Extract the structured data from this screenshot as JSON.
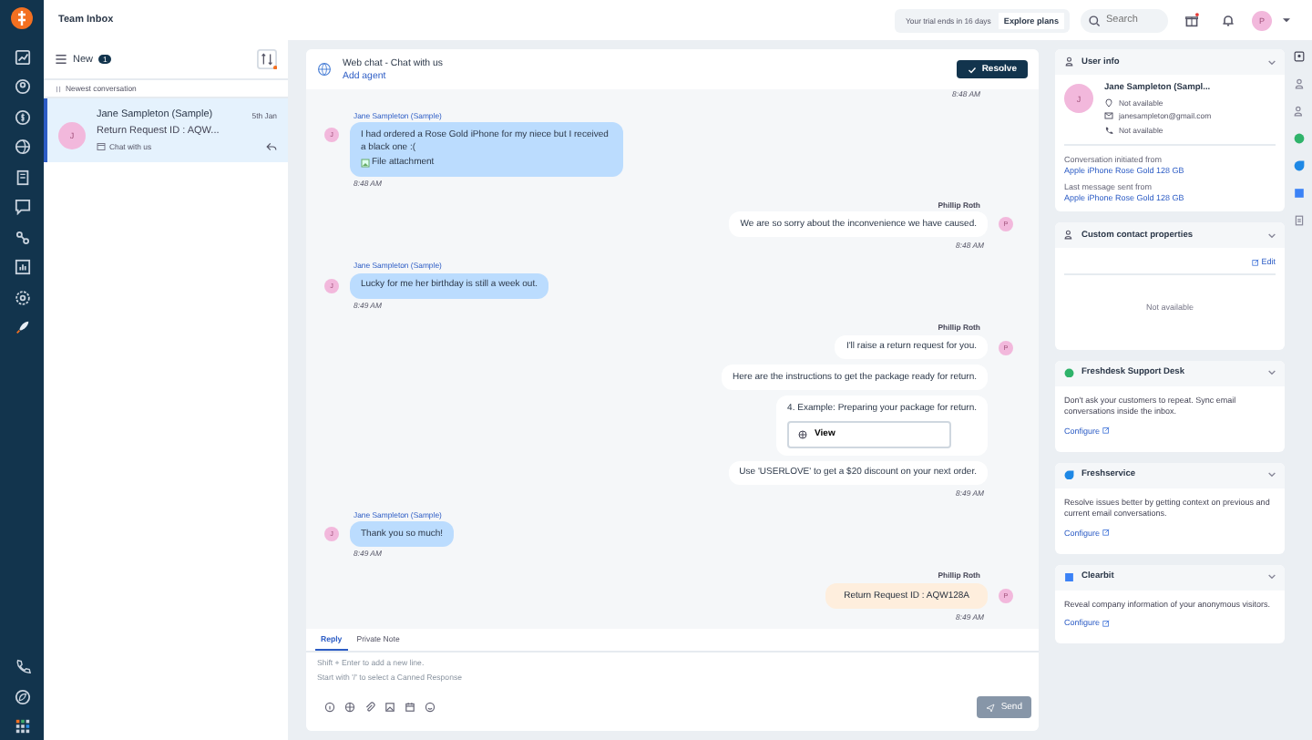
{
  "topbar": {
    "title": "Team Inbox",
    "trial_text": "Your trial ends in 16 days",
    "explore_button": "Explore plans",
    "search_placeholder": "Search",
    "avatar": "P"
  },
  "conversation_list": {
    "filter": "New",
    "count": "1",
    "sort_label": "Newest conversation",
    "items": [
      {
        "avatar": "J",
        "name": "Jane Sampleton (Sample)",
        "date": "5th Jan",
        "preview": "Return Request ID : AQW...",
        "channel": "Chat with us",
        "selected": true
      }
    ]
  },
  "chat": {
    "title": "Web chat - Chat with us",
    "add_agent": "Add agent",
    "resolve_button": "Resolve",
    "top_time": "8:48 AM",
    "messages": [
      {
        "kind": "customer",
        "sender": "Jane Sampleton (Sample)",
        "avatar": "J",
        "time": "8:48 AM",
        "bubbles": [
          {
            "kind": "text",
            "text": "I had ordered a Rose Gold iPhone for my niece but I received a black one :(",
            "attachment": "File attachment"
          }
        ]
      },
      {
        "kind": "agent",
        "sender": "Phillip Roth",
        "avatar": "P",
        "time": "8:48 AM",
        "bubbles": [
          {
            "kind": "text",
            "text": "We are so sorry about the inconvenience we have caused."
          }
        ]
      },
      {
        "kind": "customer",
        "sender": "Jane Sampleton (Sample)",
        "avatar": "J",
        "time": "8:49 AM",
        "bubbles": [
          {
            "kind": "text",
            "text": "Lucky for me her birthday is still a week out."
          }
        ]
      },
      {
        "kind": "agent",
        "sender": "Phillip Roth",
        "avatar": "P",
        "time": "8:49 AM",
        "bubbles": [
          {
            "kind": "text",
            "text": "I'll raise a return request for you."
          },
          {
            "kind": "text",
            "text": "Here are the instructions to get the package ready for return."
          },
          {
            "kind": "card",
            "text": "4. Example: Preparing your package for return.",
            "button": "View"
          },
          {
            "kind": "text",
            "text": "Use 'USERLOVE' to get a $20 discount on your next order."
          }
        ]
      },
      {
        "kind": "customer",
        "sender": "Jane Sampleton (Sample)",
        "avatar": "J",
        "time": "8:49 AM",
        "bubbles": [
          {
            "kind": "text",
            "text": "Thank you so much!"
          }
        ]
      },
      {
        "kind": "agent",
        "sender": "Phillip Roth",
        "avatar": "P",
        "time": "8:49 AM",
        "bubbles": [
          {
            "kind": "highlight",
            "text": "Return Request ID : AQW128A"
          }
        ]
      }
    ],
    "composer": {
      "tabs": [
        {
          "label": "Reply",
          "selected": true
        },
        {
          "label": "Private Note",
          "selected": false
        }
      ],
      "placeholder": "Shift + Enter to add a new line.\nStart with '/' to select a Canned Response",
      "send_button": "Send",
      "send_disabled": true
    }
  },
  "user_info": {
    "title": "User info",
    "avatar": "J",
    "name": "Jane Sampleton (Sampl...",
    "location": "Not available",
    "email": "janesampleton@gmail.com",
    "phone": "Not available",
    "initiated_label": "Conversation initiated from",
    "initiated_value": "Apple iPhone Rose Gold 128 GB",
    "last_label": "Last message sent from",
    "last_value": "Apple iPhone Rose Gold 128 GB"
  },
  "custom_properties": {
    "title": "Custom contact properties",
    "edit": "Edit",
    "empty": "Not available"
  },
  "apps": [
    {
      "kind": "freshdesk",
      "title": "Freshdesk Support Desk",
      "description": "Don't ask your customers to repeat. Sync email conversations inside the inbox.",
      "link": "Configure"
    },
    {
      "kind": "freshservice",
      "title": "Freshservice",
      "description": "Resolve issues better by getting context on previous and current email conversations.",
      "link": "Configure"
    },
    {
      "kind": "clearbit",
      "title": "Clearbit",
      "description": "Reveal company information of your anonymous visitors.",
      "link": "Configure"
    }
  ]
}
